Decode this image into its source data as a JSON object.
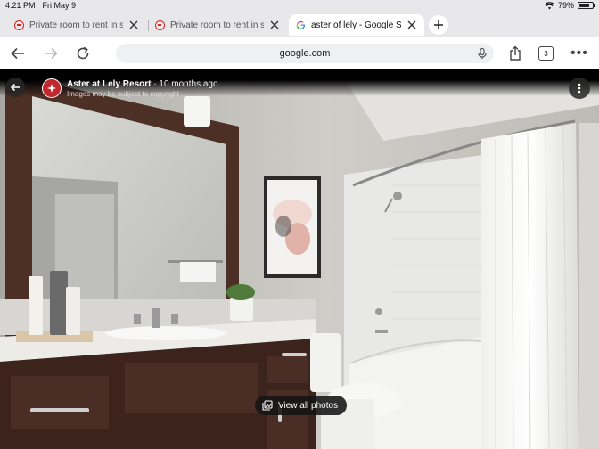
{
  "status_bar": {
    "time": "4:21 PM",
    "date": "Fri May 9",
    "battery": "79%",
    "battery_level": 0.79
  },
  "tabs": [
    {
      "label": "Private room to rent in sa",
      "active": false
    },
    {
      "label": "Private room to rent in sa",
      "active": false
    },
    {
      "label": "aster of lely - Google Sea",
      "active": true
    }
  ],
  "toolbar": {
    "url": "google.com",
    "tab_count": "3"
  },
  "viewer": {
    "source_name": "Aster at Lely Resort",
    "separator": "·",
    "age": "10 months ago",
    "copyright_notice": "Images may be subject to copyright",
    "view_all_label": "View all photos"
  },
  "icons": {
    "back": "arrow-left-icon",
    "forward": "arrow-right-icon",
    "reload": "reload-icon",
    "mic": "microphone-icon",
    "share": "share-icon",
    "menu": "kebab-menu-icon",
    "gallery": "photo-gallery-icon",
    "wifi": "wifi-icon",
    "battery": "battery-icon"
  },
  "colors": {
    "brand_logo": "#c1272d",
    "omnibox_bg": "#eef0f2",
    "chrome_bg": "#e8e8ea"
  }
}
